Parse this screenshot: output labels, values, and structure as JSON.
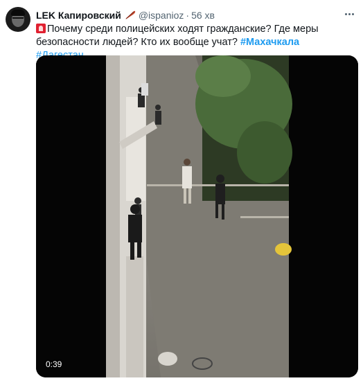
{
  "tweet": {
    "author_name": "LEK Капировский",
    "handle": "@ispanioz",
    "separator": "·",
    "time": "56 хв",
    "text_main": "Почему среди полицейских ходят гражданские? Где меры безопасности людей? Кто их вообще учат?",
    "hashtags": [
      "#Махачкала",
      "#Дагестан"
    ],
    "video_duration": "0:39"
  },
  "icons": {
    "badge": "feather-icon",
    "emoji": "police-light-icon",
    "menu": "more-options-icon"
  },
  "colors": {
    "link": "#1d9bf0",
    "secondary_text": "#536471",
    "primary_text": "#0f1419"
  }
}
